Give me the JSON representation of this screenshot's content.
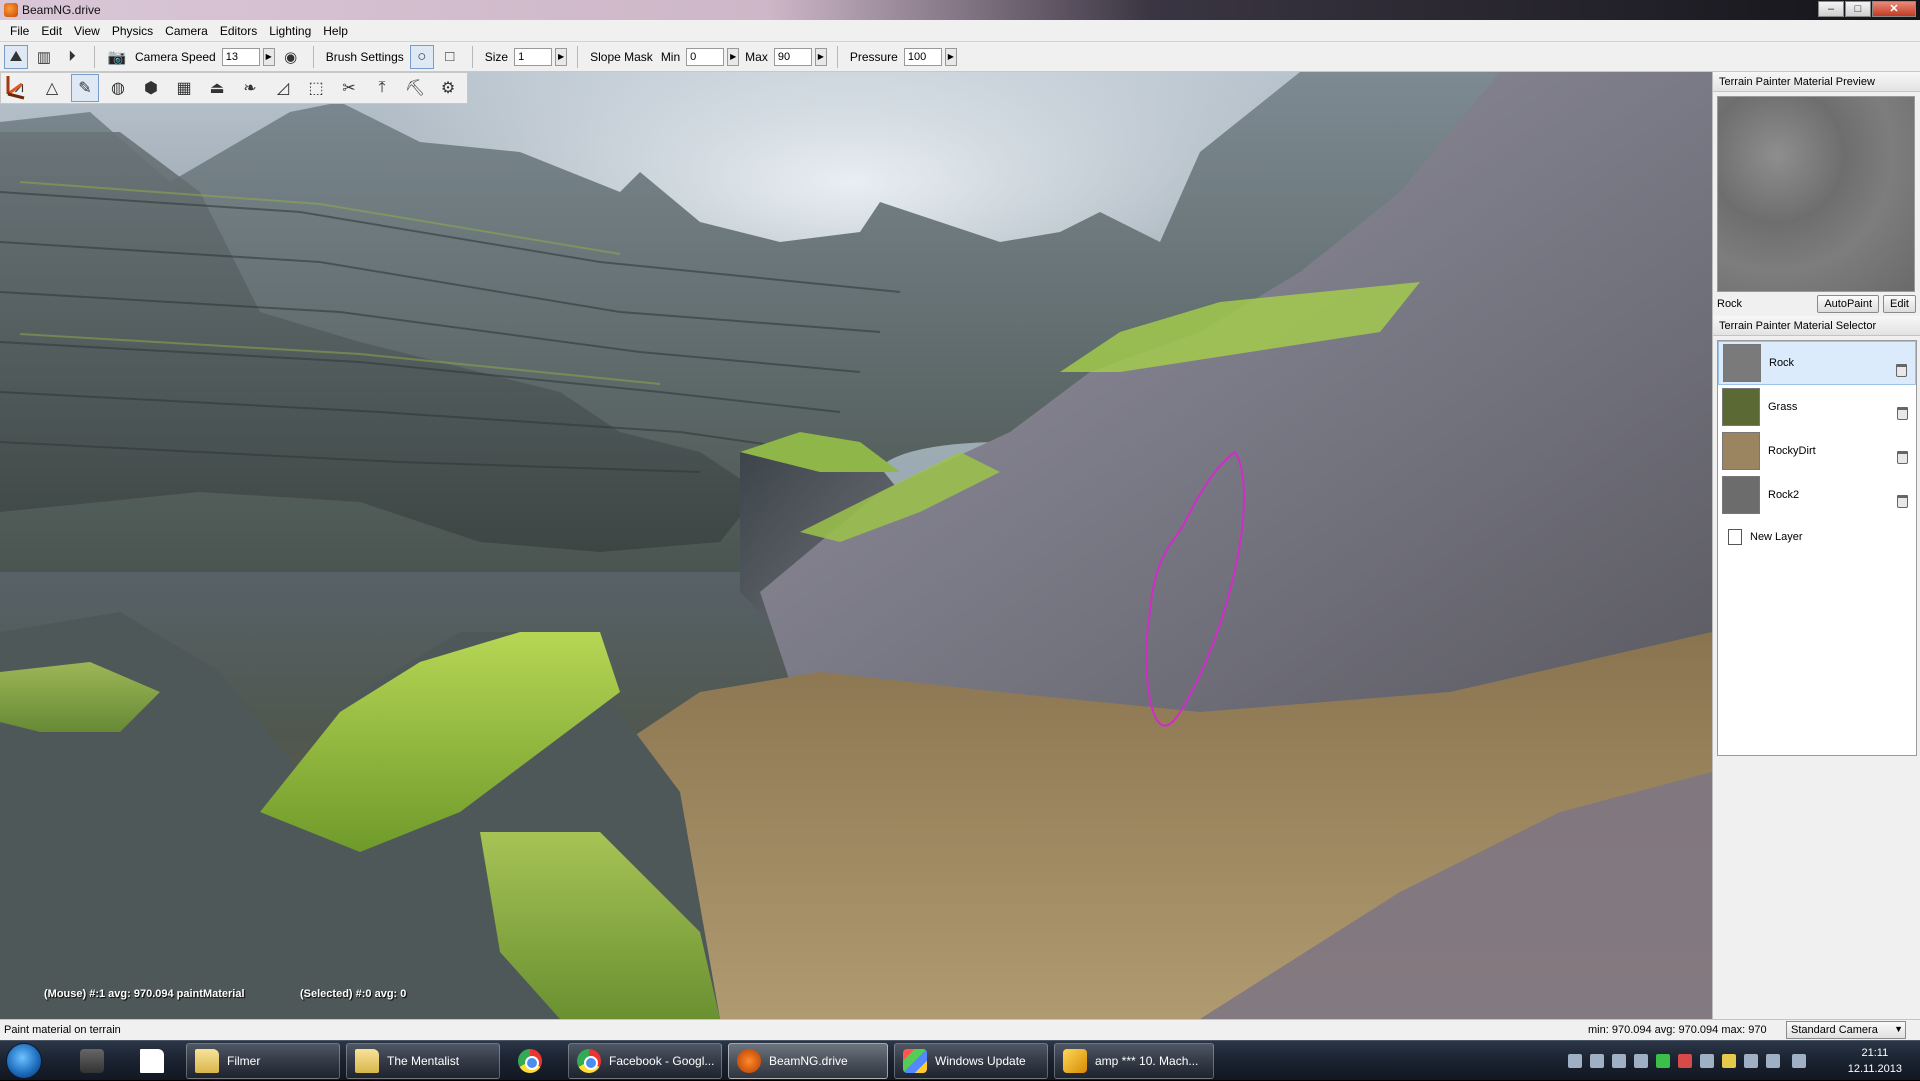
{
  "window": {
    "title": "BeamNG.drive"
  },
  "menu": [
    "File",
    "Edit",
    "View",
    "Physics",
    "Camera",
    "Editors",
    "Lighting",
    "Help"
  ],
  "toolbar": {
    "camera_speed_label": "Camera Speed",
    "camera_speed_value": "13",
    "brush_settings_label": "Brush Settings",
    "size_label": "Size",
    "size_value": "1",
    "slope_mask_label": "Slope Mask",
    "min_label": "Min",
    "min_value": "0",
    "max_label": "Max",
    "max_value": "90",
    "pressure_label": "Pressure",
    "pressure_value": "100"
  },
  "hud": {
    "mouse": "(Mouse) #:1  avg: 970.094  paintMaterial",
    "selected": "(Selected) #:0  avg: 0"
  },
  "preview_panel": {
    "title": "Terrain Painter Material Preview",
    "material_name": "Rock",
    "autopaint_label": "AutoPaint",
    "edit_label": "Edit"
  },
  "selector_panel": {
    "title": "Terrain Painter Material Selector",
    "materials": [
      {
        "name": "Rock",
        "color": "#7a7a7a",
        "selected": true
      },
      {
        "name": "Grass",
        "color": "#5b6a35",
        "selected": false
      },
      {
        "name": "RockyDirt",
        "color": "#9a8560",
        "selected": false
      },
      {
        "name": "Rock2",
        "color": "#6c6c6c",
        "selected": false
      }
    ],
    "new_layer_label": "New Layer"
  },
  "status": {
    "left": "Paint material on terrain",
    "right": "min: 970.094  avg: 970.094  max: 970",
    "camera_mode": "Standard Camera"
  },
  "taskbar": {
    "apps": [
      {
        "label": "Filmer",
        "icon": "folder-icon"
      },
      {
        "label": "The Mentalist",
        "icon": "folder-icon"
      },
      {
        "label": "Facebook - Googl...",
        "icon": "chrome-icon"
      },
      {
        "label": "BeamNG.drive",
        "icon": "beamng-icon"
      },
      {
        "label": "Windows Update",
        "icon": "windows-update-icon"
      },
      {
        "label": "amp *** 10. Mach...",
        "icon": "amp-icon"
      }
    ],
    "time": "21:11",
    "date": "12.11.2013"
  }
}
